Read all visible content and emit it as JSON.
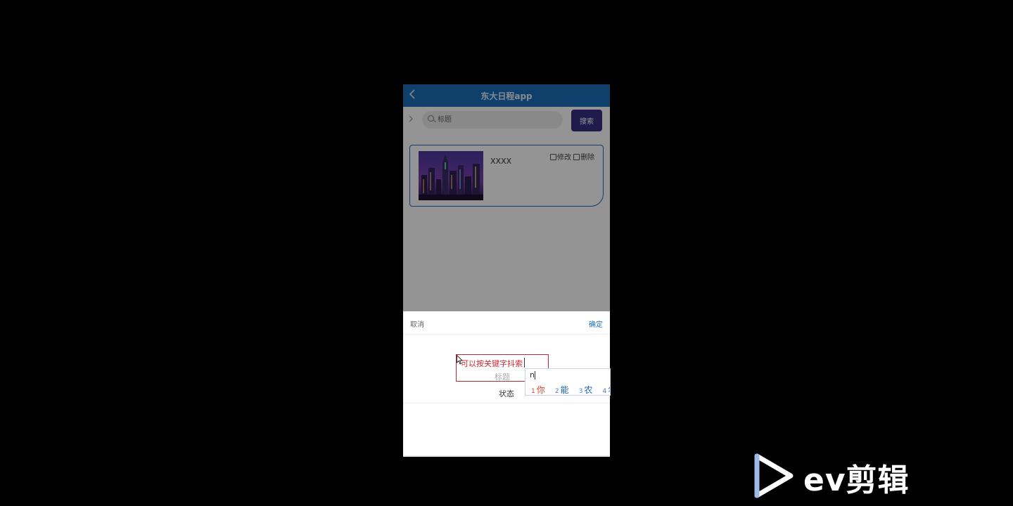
{
  "header": {
    "title": "东大日程app",
    "back_icon": "chevron-left-icon"
  },
  "search": {
    "placeholder": "标题",
    "button_label": "搜索"
  },
  "card": {
    "title": "XXXX",
    "edit_label": "修改",
    "delete_label": "删除"
  },
  "picker": {
    "cancel_label": "取消",
    "confirm_label": "确定",
    "hint_text": "可以按关键字抖索",
    "field_title": "标题",
    "status_label": "状态"
  },
  "ime": {
    "pinyin": "n",
    "candidates": [
      {
        "num": "1",
        "char": "你"
      },
      {
        "num": "2",
        "char": "能"
      },
      {
        "num": "3",
        "char": "农"
      },
      {
        "num": "4",
        "char": "年"
      }
    ]
  },
  "watermark": {
    "text": "ev剪辑"
  },
  "colors": {
    "header_bg": "#1a6fb8",
    "search_button_bg": "#3a2d86",
    "card_border": "#2a68b8",
    "highlight_border": "#c0262e",
    "confirm_text": "#1a6fb8"
  }
}
